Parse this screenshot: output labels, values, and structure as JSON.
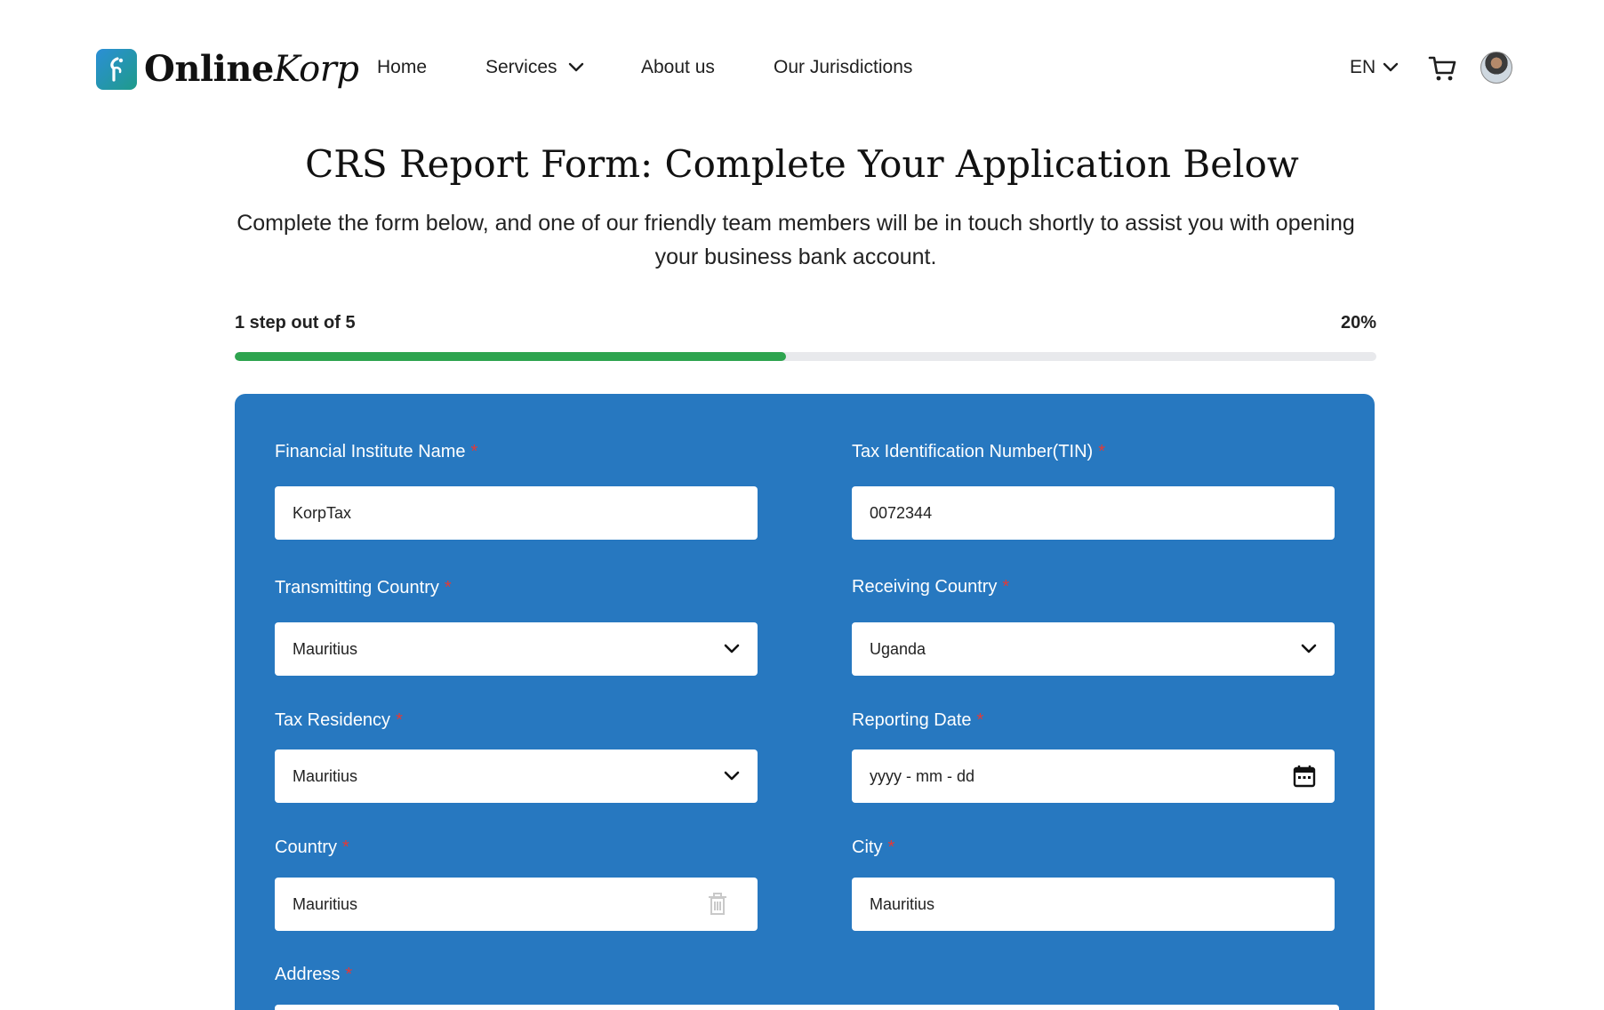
{
  "brand": {
    "name_bold": "Online",
    "name_italic": "Korp"
  },
  "nav": {
    "home": "Home",
    "services": "Services",
    "about": "About us",
    "jurisdictions": "Our Jurisdictions"
  },
  "header": {
    "language": "EN"
  },
  "page": {
    "title": "CRS Report Form: Complete Your Application Below",
    "subtitle": "Complete the form below, and one of our friendly team members will be in touch shortly to assist you with opening your business bank account."
  },
  "progress": {
    "label": "1 step out of 5",
    "percent_text": "20%",
    "fraction": 0.2
  },
  "form": {
    "required_marker": "*",
    "institute_name": {
      "label": "Financial Institute Name",
      "value": "KorpTax"
    },
    "tin": {
      "label": "Tax Identification Number(TIN)",
      "value": "0072344"
    },
    "transmitting_country": {
      "label": "Transmitting Country",
      "value": "Mauritius"
    },
    "receiving_country": {
      "label": "Receiving Country",
      "value": "Uganda"
    },
    "tax_residency": {
      "label": "Tax Residency",
      "value": "Mauritius"
    },
    "reporting_date": {
      "label": "Reporting Date",
      "placeholder": "yyyy - mm - dd"
    },
    "country": {
      "label": "Country",
      "value": "Mauritius"
    },
    "city": {
      "label": "City",
      "value": "Mauritius"
    },
    "address": {
      "label": "Address"
    }
  },
  "colors": {
    "card": "#2778c0",
    "progress": "#2ea44f",
    "required": "#e53935"
  },
  "icons": [
    "chevron-down-icon",
    "cart-icon",
    "calendar-icon",
    "trash-icon"
  ]
}
